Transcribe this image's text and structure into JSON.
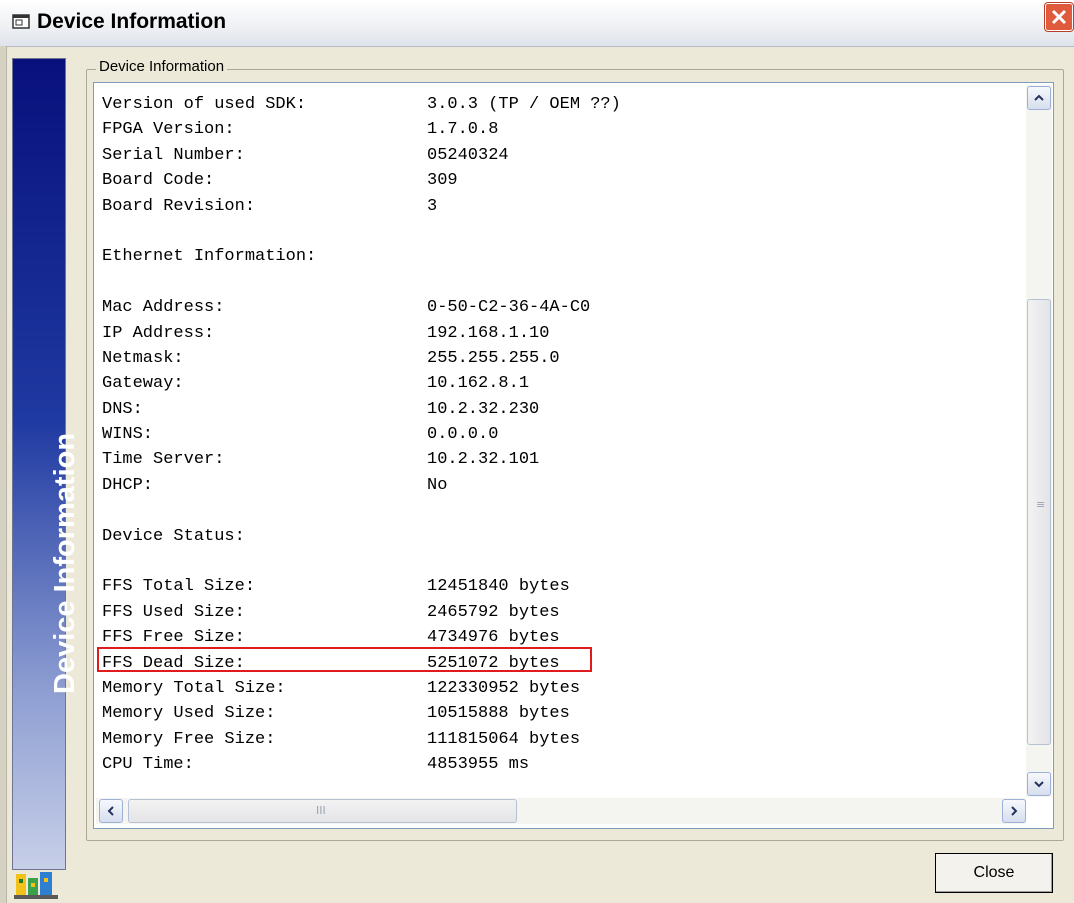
{
  "window": {
    "title": "Device Information",
    "side_panel_text": "Device Information",
    "group_label": "Device Information",
    "close_button_label": "Close"
  },
  "info_rows": [
    {
      "label": "Version of used SDK:",
      "value": "3.0.3 (TP / OEM ??)"
    },
    {
      "label": "FPGA Version:",
      "value": "1.7.0.8"
    },
    {
      "label": "Serial Number:",
      "value": "05240324"
    },
    {
      "label": "Board Code:",
      "value": "309"
    },
    {
      "label": "Board Revision:",
      "value": "3"
    },
    {
      "label": "",
      "value": ""
    },
    {
      "label": "Ethernet Information:",
      "value": ""
    },
    {
      "label": "",
      "value": ""
    },
    {
      "label": "Mac Address:",
      "value": "0-50-C2-36-4A-C0"
    },
    {
      "label": "IP Address:",
      "value": "192.168.1.10"
    },
    {
      "label": "Netmask:",
      "value": "255.255.255.0"
    },
    {
      "label": "Gateway:",
      "value": "10.162.8.1"
    },
    {
      "label": "DNS:",
      "value": "10.2.32.230"
    },
    {
      "label": "WINS:",
      "value": "0.0.0.0"
    },
    {
      "label": "Time Server:",
      "value": "10.2.32.101"
    },
    {
      "label": "DHCP:",
      "value": "No"
    },
    {
      "label": "",
      "value": ""
    },
    {
      "label": "Device Status:",
      "value": ""
    },
    {
      "label": "",
      "value": ""
    },
    {
      "label": "FFS Total Size:",
      "value": "12451840 bytes"
    },
    {
      "label": "FFS Used Size:",
      "value": "2465792 bytes"
    },
    {
      "label": "FFS Free Size:",
      "value": "4734976 bytes"
    },
    {
      "label": "FFS Dead Size:",
      "value": "5251072 bytes"
    },
    {
      "label": "Memory Total Size:",
      "value": "122330952 bytes"
    },
    {
      "label": "Memory Used Size:",
      "value": "10515888 bytes"
    },
    {
      "label": "Memory Free Size:",
      "value": "111815064 bytes"
    },
    {
      "label": "CPU Time:",
      "value": "4853955 ms"
    }
  ],
  "icons": {
    "title": "window-icon",
    "close": "close-icon",
    "scroll_up": "arrow-up-icon",
    "scroll_down": "arrow-down-icon",
    "scroll_left": "arrow-left-icon",
    "scroll_right": "arrow-right-icon",
    "logo": "app-logo-icon"
  },
  "colors": {
    "highlight": "#e01b1b",
    "side_panel_top": "#08107c",
    "close_button": "#e05a3e"
  }
}
